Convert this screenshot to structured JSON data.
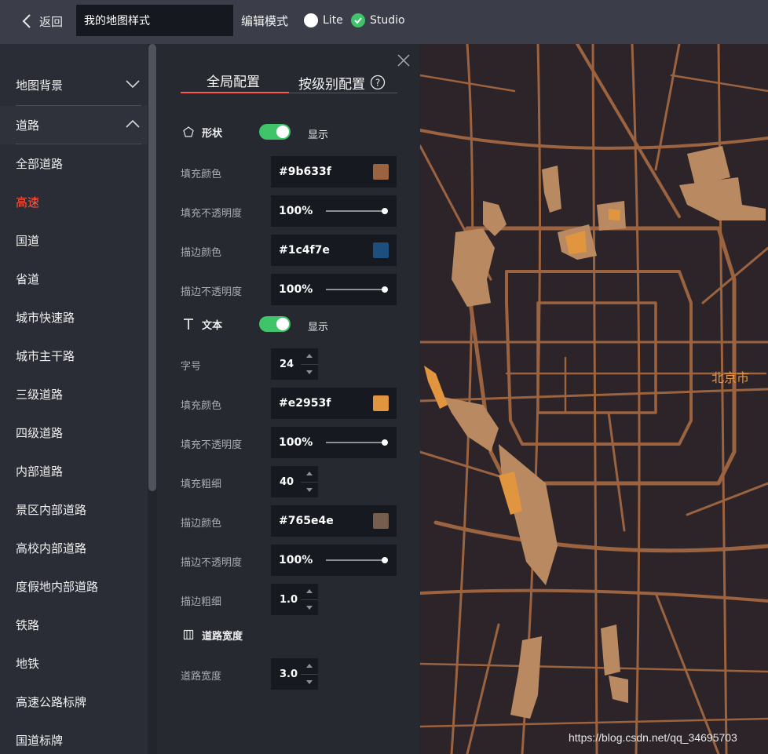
{
  "topbar": {
    "back_label": "返回",
    "style_name": "我的地图样式",
    "mode_label": "编辑模式",
    "lite_label": "Lite",
    "studio_label": "Studio"
  },
  "sidebar": {
    "background_label": "地图背景",
    "road_label": "道路",
    "items": [
      "全部道路",
      "高速",
      "国道",
      "省道",
      "城市快速路",
      "城市主干路",
      "三级道路",
      "四级道路",
      "内部道路",
      "景区内部道路",
      "高校内部道路",
      "度假地内部道路",
      "铁路",
      "地铁",
      "高速公路标牌",
      "国道标牌"
    ],
    "active_item": "高速"
  },
  "panel": {
    "tabs": {
      "global": "全局配置",
      "level": "按级别配置"
    },
    "shape": {
      "title": "形状",
      "toggle_label": "显示",
      "fill_color_label": "填充颜色",
      "fill_color": "#9b633f",
      "fill_opacity_label": "填充不透明度",
      "fill_opacity": "100%",
      "stroke_color_label": "描边颜色",
      "stroke_color": "#1c4f7e",
      "stroke_opacity_label": "描边不透明度",
      "stroke_opacity": "100%"
    },
    "text": {
      "title": "文本",
      "toggle_label": "显示",
      "font_size_label": "字号",
      "font_size": "24",
      "fill_color_label": "填充颜色",
      "fill_color": "#e2953f",
      "fill_opacity_label": "填充不透明度",
      "fill_opacity": "100%",
      "fill_weight_label": "填充粗细",
      "fill_weight": "40",
      "stroke_color_label": "描边颜色",
      "stroke_color": "#765e4e",
      "stroke_opacity_label": "描边不透明度",
      "stroke_opacity": "100%",
      "stroke_weight_label": "描边粗细",
      "stroke_weight": "1.0"
    },
    "road_width": {
      "title": "道路宽度",
      "label": "道路宽度",
      "value": "3.0"
    }
  },
  "map": {
    "city_label": "北京市",
    "watermark": "https://blog.csdn.net/qq_34695703",
    "road_color": "#9b633f",
    "area_color": "#b98a62",
    "water_color": "#e2953f"
  }
}
